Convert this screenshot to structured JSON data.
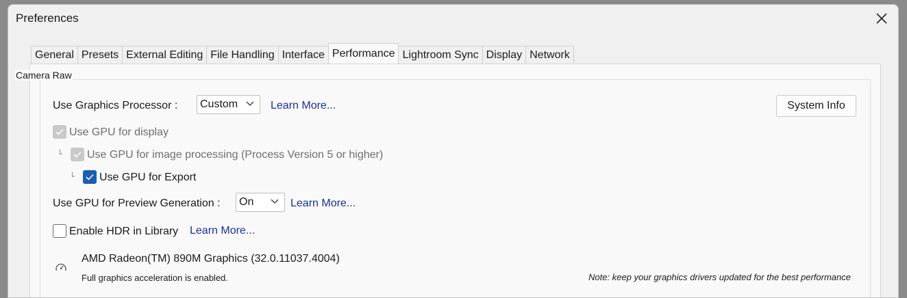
{
  "window": {
    "title": "Preferences"
  },
  "tabs": [
    {
      "label": "General"
    },
    {
      "label": "Presets"
    },
    {
      "label": "External Editing"
    },
    {
      "label": "File Handling"
    },
    {
      "label": "Interface"
    },
    {
      "label": "Performance",
      "active": true
    },
    {
      "label": "Lightroom Sync"
    },
    {
      "label": "Display"
    },
    {
      "label": "Network"
    }
  ],
  "camera_raw": {
    "group_label": "Camera Raw",
    "graphics_processor": {
      "label": "Use Graphics Processor :",
      "value": "Custom",
      "learn_more": "Learn More..."
    },
    "system_info_label": "System Info",
    "gpu_display": {
      "label": "Use GPU for display",
      "checked": true,
      "disabled": true
    },
    "gpu_image_processing": {
      "label": "Use GPU for image processing (Process Version 5 or higher)",
      "checked": true,
      "disabled": true
    },
    "gpu_export": {
      "label": "Use GPU for Export",
      "checked": true,
      "disabled": false
    },
    "tree_glyph": "└",
    "preview_generation": {
      "label": "Use GPU for Preview Generation :",
      "value": "On",
      "learn_more": "Learn More..."
    },
    "hdr_library": {
      "label": "Enable HDR in Library",
      "checked": false,
      "learn_more": "Learn More..."
    },
    "gpu_name": "AMD Radeon(TM) 890M Graphics (32.0.11037.4004)",
    "gpu_status": "Full graphics acceleration is enabled.",
    "driver_note": "Note: keep your graphics drivers updated for the best performance"
  },
  "icons": {
    "close": "close-icon",
    "chevron": "chevron-down-icon",
    "check": "checkmark-icon",
    "gauge": "speedometer-icon"
  },
  "colors": {
    "accent": "#1a5fb4",
    "link": "#1a2f9a",
    "disabled": "#c9c9c9"
  }
}
